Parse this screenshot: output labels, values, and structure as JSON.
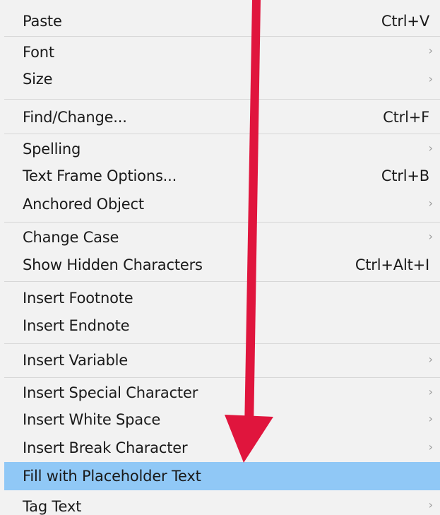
{
  "context_menu": {
    "items": [
      {
        "label": "Paste",
        "shortcut": "Ctrl+V",
        "submenu": false
      },
      {
        "label": "Font",
        "shortcut": "",
        "submenu": true
      },
      {
        "label": "Size",
        "shortcut": "",
        "submenu": true
      },
      {
        "label": "Find/Change...",
        "shortcut": "Ctrl+F",
        "submenu": false
      },
      {
        "label": "Spelling",
        "shortcut": "",
        "submenu": true
      },
      {
        "label": "Text Frame Options...",
        "shortcut": "Ctrl+B",
        "submenu": false
      },
      {
        "label": "Anchored Object",
        "shortcut": "",
        "submenu": true
      },
      {
        "label": "Change Case",
        "shortcut": "",
        "submenu": true
      },
      {
        "label": "Show Hidden Characters",
        "shortcut": "Ctrl+Alt+I",
        "submenu": false
      },
      {
        "label": "Insert Footnote",
        "shortcut": "",
        "submenu": false
      },
      {
        "label": "Insert Endnote",
        "shortcut": "",
        "submenu": false
      },
      {
        "label": "Insert Variable",
        "shortcut": "",
        "submenu": true
      },
      {
        "label": "Insert Special Character",
        "shortcut": "",
        "submenu": true
      },
      {
        "label": "Insert White Space",
        "shortcut": "",
        "submenu": true
      },
      {
        "label": "Insert Break Character",
        "shortcut": "",
        "submenu": true
      },
      {
        "label": "Fill with Placeholder Text",
        "shortcut": "",
        "submenu": false,
        "highlighted": true
      },
      {
        "label": "Tag Text",
        "shortcut": "",
        "submenu": true
      }
    ]
  },
  "colors": {
    "menu_background": "#f2f2f2",
    "highlight": "#90c8f6",
    "arrow": "#e0153d",
    "chevron": "#9a9a9a"
  },
  "annotation": {
    "arrow_icon": "red-down-arrow-icon",
    "submenu_icon": "chevron-right-icon"
  }
}
